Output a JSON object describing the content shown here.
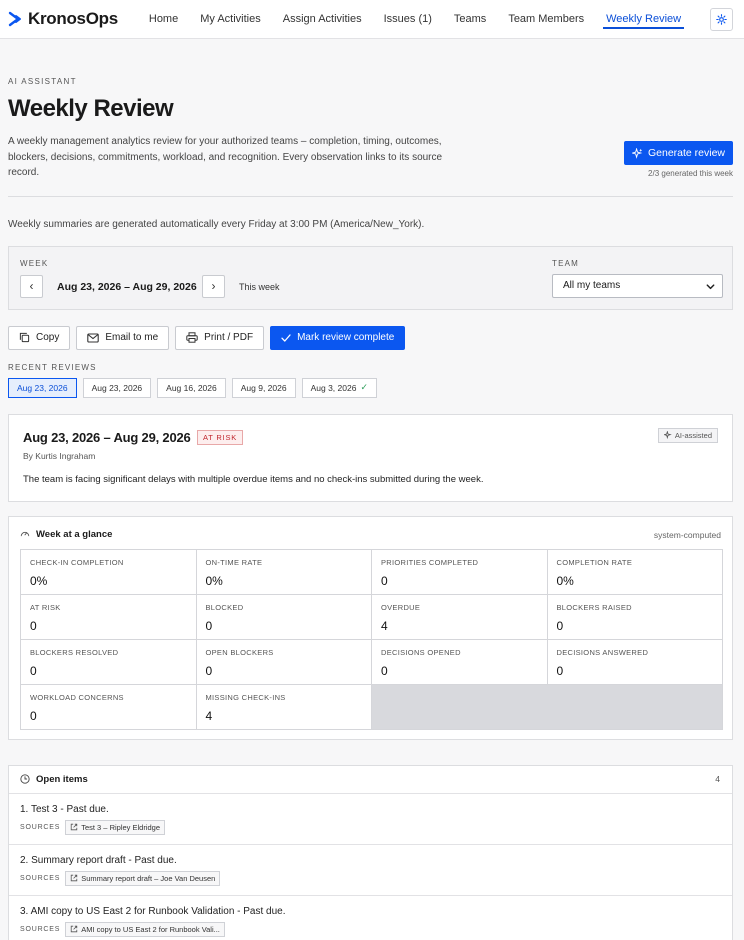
{
  "nav": {
    "brand": "KronosOps",
    "links": [
      "Home",
      "My Activities",
      "Assign Activities",
      "Issues (1)",
      "Teams",
      "Team Members",
      "Weekly Review"
    ],
    "active_index": 6
  },
  "header": {
    "eyebrow": "AI ASSISTANT",
    "title": "Weekly Review",
    "description": "A weekly management analytics review for your authorized teams – completion, timing, outcomes, blockers, decisions, commitments, workload, and recognition. Every observation links to its source record.",
    "generate_label": "Generate review",
    "generate_count": "2/3 generated this week"
  },
  "auto_note": "Weekly summaries are generated automatically every Friday at 3:00 PM (America/New_York).",
  "week": {
    "label": "WEEK",
    "range": "Aug 23, 2026 – Aug 29, 2026",
    "this_week": "This week",
    "team_label": "TEAM",
    "team_value": "All my teams"
  },
  "actions": {
    "copy": "Copy",
    "email": "Email to me",
    "print": "Print / PDF",
    "complete": "Mark review complete"
  },
  "recent": {
    "label": "RECENT REVIEWS",
    "chips": [
      "Aug 23, 2026",
      "Aug 23, 2026",
      "Aug 16, 2026",
      "Aug 9, 2026",
      "Aug 3, 2026"
    ]
  },
  "summary": {
    "title": "Aug 23, 2026 – Aug 29, 2026",
    "status": "AT RISK",
    "ai_label": "AI-assisted",
    "author": "By Kurtis Ingraham",
    "text": "The team is facing significant delays with multiple overdue items and no check-ins submitted during the week."
  },
  "glance": {
    "title": "Week at a glance",
    "source": "system-computed",
    "metrics": [
      {
        "label": "CHECK-IN COMPLETION",
        "value": "0%"
      },
      {
        "label": "ON-TIME RATE",
        "value": "0%"
      },
      {
        "label": "PRIORITIES COMPLETED",
        "value": "0"
      },
      {
        "label": "COMPLETION RATE",
        "value": "0%"
      },
      {
        "label": "AT RISK",
        "value": "0"
      },
      {
        "label": "BLOCKED",
        "value": "0"
      },
      {
        "label": "OVERDUE",
        "value": "4"
      },
      {
        "label": "BLOCKERS RAISED",
        "value": "0"
      },
      {
        "label": "BLOCKERS RESOLVED",
        "value": "0"
      },
      {
        "label": "OPEN BLOCKERS",
        "value": "0"
      },
      {
        "label": "DECISIONS OPENED",
        "value": "0"
      },
      {
        "label": "DECISIONS ANSWERED",
        "value": "0"
      },
      {
        "label": "WORKLOAD CONCERNS",
        "value": "0"
      },
      {
        "label": "MISSING CHECK-INS",
        "value": "4"
      }
    ]
  },
  "open_items": {
    "title": "Open items",
    "count": "4",
    "sources_label": "SOURCES",
    "items": [
      {
        "text": "1.  Test 3 - Past due.",
        "source": "Test 3 – Ripley Eldridge"
      },
      {
        "text": "2.  Summary report draft - Past due.",
        "source": "Summary report draft – Joe Van Deusen"
      },
      {
        "text": "3.  AMI copy to US East 2 for Runbook Validation - Past due.",
        "source": "AMI copy to US East 2 for Runbook Vali..."
      }
    ]
  },
  "colors": {
    "accent": "#0b57f0",
    "risk": "#c0262d",
    "success": "#2e9e5b"
  }
}
